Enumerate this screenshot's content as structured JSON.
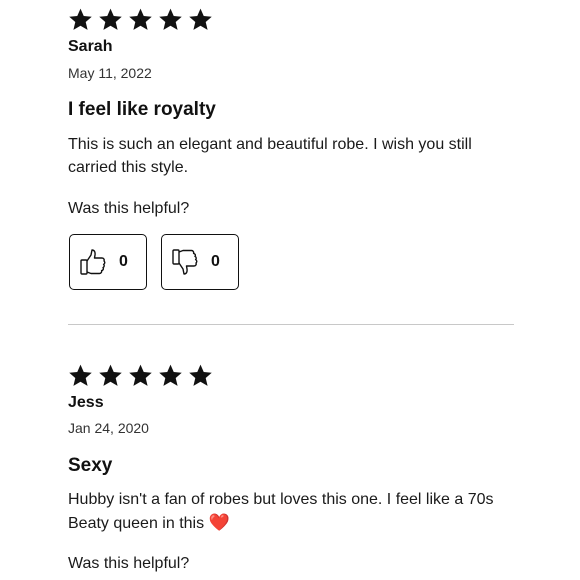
{
  "reviews": [
    {
      "rating": 5,
      "reviewer": "Sarah",
      "date": "May 11, 2022",
      "title": "I feel like royalty",
      "body": "This is such an elegant and beautiful robe. I wish you still carried this style.",
      "helpful_prompt": "Was this helpful?",
      "upvotes": "0",
      "downvotes": "0"
    },
    {
      "rating": 5,
      "reviewer": "Jess",
      "date": "Jan 24, 2020",
      "title": "Sexy",
      "body": "Hubby isn't a fan of robes but loves this one. I feel like a 70s Beaty queen in this",
      "body_emoji": "❤️",
      "helpful_prompt": "Was this helpful?"
    }
  ],
  "icons": {
    "star": "star-icon",
    "thumbs_up": "thumbs-up-icon",
    "thumbs_down": "thumbs-down-icon",
    "heart": "heart-emoji"
  },
  "colors": {
    "text": "#111111",
    "divider": "#c8c8c8",
    "heart": "#e0242c"
  }
}
